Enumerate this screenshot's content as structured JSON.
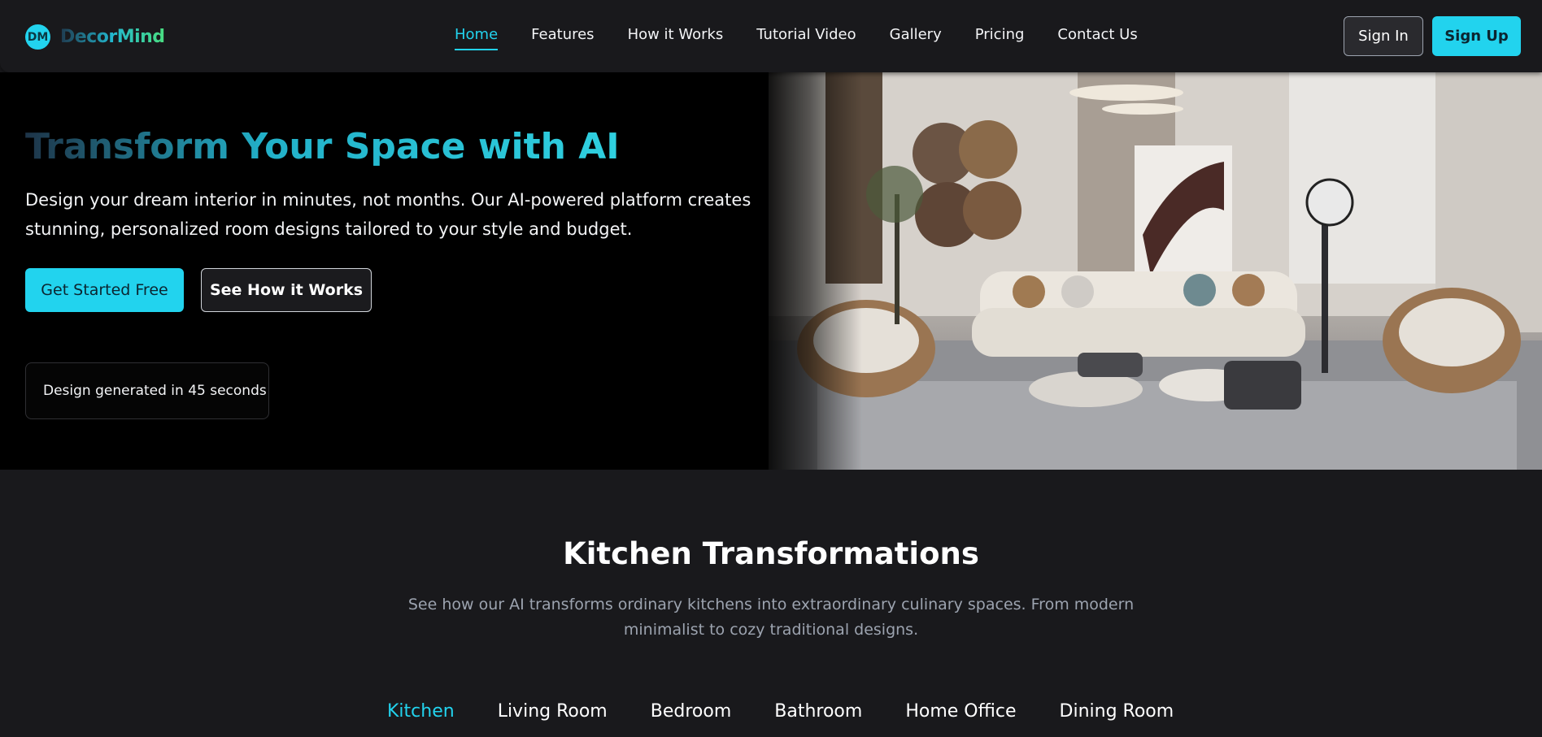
{
  "header": {
    "logo_badge": "DM",
    "logo_text": "DecorMind",
    "nav": [
      "Home",
      "Features",
      "How it Works",
      "Tutorial Video",
      "Gallery",
      "Pricing",
      "Contact Us"
    ],
    "active_nav": "Home",
    "sign_in": "Sign In",
    "sign_up": "Sign Up"
  },
  "hero": {
    "title": "Transform Your Space with AI",
    "subtitle": "Design your dream interior in minutes, not months. Our AI-powered platform creates stunning, personalized room designs tailored to your style and budget.",
    "primary_cta": "Get Started Free",
    "secondary_cta": "See How it Works",
    "status_card": "Design generated in 45 seconds"
  },
  "section": {
    "title": "Kitchen Transformations",
    "subtitle": "See how our AI transforms ordinary kitchens into extraordinary culinary spaces. From modern minimalist to cozy traditional designs.",
    "tabs": [
      "Kitchen",
      "Living Room",
      "Bedroom",
      "Bathroom",
      "Home Office",
      "Dining Room"
    ],
    "active_tab": "Kitchen"
  },
  "colors": {
    "accent": "#22d3ee",
    "background": "#19191c",
    "hero_background": "#000000",
    "muted_text": "#9ca3af"
  }
}
